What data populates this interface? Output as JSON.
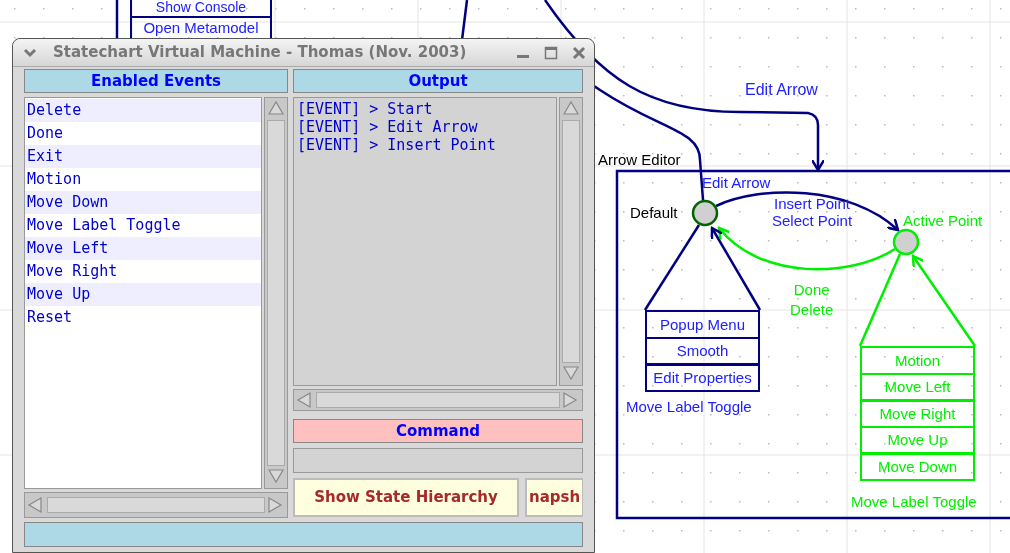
{
  "diagram": {
    "partial_menu": [
      "Show Console",
      "Open Metamodel"
    ],
    "incoming_label": "Edit Arrow",
    "composite": {
      "title": "Arrow Editor",
      "entry_label": "Edit Arrow",
      "states": [
        {
          "name": "Default",
          "active": false,
          "actions": [
            "Popup Menu",
            "Smooth",
            "Edit Properties"
          ],
          "footer": "Move Label Toggle"
        },
        {
          "name": "Active Point",
          "active": true,
          "actions": [
            "Motion",
            "Move Left",
            "Move Right",
            "Move Up",
            "Move Down"
          ],
          "footer": "Move Label Toggle"
        }
      ],
      "transitions": [
        {
          "labels": [
            "Insert Point",
            "Select Point"
          ],
          "active": false
        },
        {
          "labels": [
            "Done",
            "Delete"
          ],
          "active": true
        }
      ]
    }
  },
  "window": {
    "title": "Statechart Virtual Machine - Thomas (Nov. 2003)",
    "events": {
      "header": "Enabled Events",
      "items": [
        "Delete",
        "Done",
        "Exit",
        "Motion",
        "Move Down",
        "Move Label Toggle",
        "Move Left",
        "Move Right",
        "Move Up",
        "Reset"
      ]
    },
    "output": {
      "header": "Output",
      "lines": [
        "[EVENT] > Start",
        "[EVENT] > Edit Arrow",
        "[EVENT] > Insert Point"
      ]
    },
    "command": {
      "header": "Command"
    },
    "buttons": [
      "Show State Hierarchy",
      "napsh"
    ]
  }
}
